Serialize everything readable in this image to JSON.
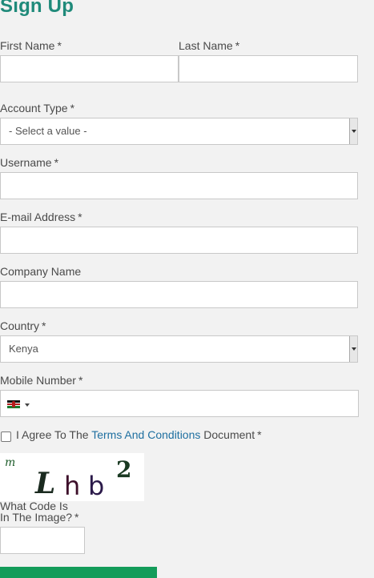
{
  "form": {
    "title": "Sign Up",
    "required_mark": "*",
    "first_name_label": "First Name",
    "last_name_label": "Last Name",
    "account_type_label": "Account Type",
    "account_type_value": "- Select a value -",
    "username_label": "Username",
    "email_label": "E-mail Address",
    "company_label": "Company Name",
    "country_label": "Country",
    "country_value": "Kenya",
    "mobile_label": "Mobile Number",
    "agree_prefix": "I Agree To The",
    "agree_link": "Terms And Conditions",
    "agree_suffix": "Document",
    "captcha_text": "mLhb2",
    "code_label_line1": "What Code Is",
    "code_label_line2": "In The Image?"
  },
  "icons": {
    "country_flag": "kenya-flag-icon",
    "flag_dropdown": "caret-down-icon",
    "select_arrow": "caret-down-icon"
  },
  "colors": {
    "title": "#1f8a7a",
    "link": "#1e6fa0",
    "submit_button": "#139c5a",
    "background": "#f2f2f2"
  }
}
